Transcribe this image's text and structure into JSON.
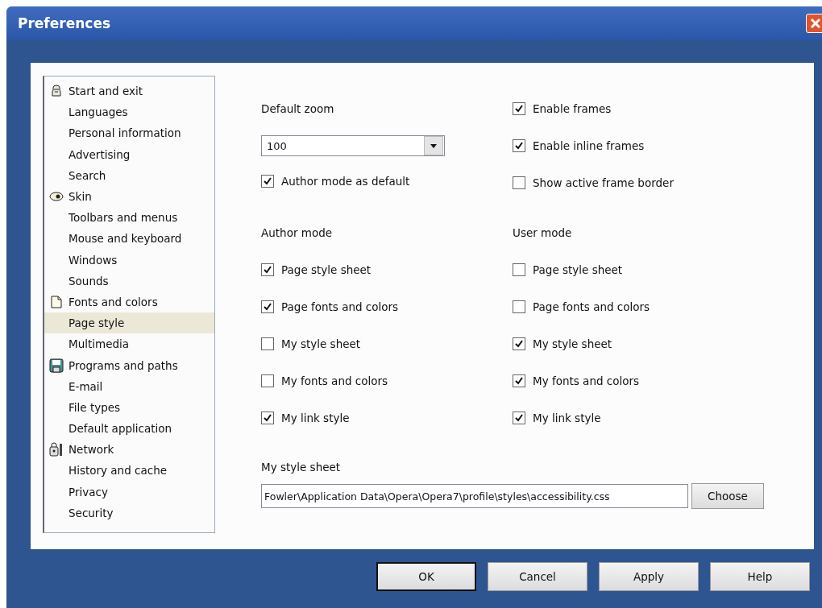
{
  "window": {
    "title": "Preferences"
  },
  "sidebar": {
    "items": [
      {
        "label": "Start and exit",
        "kind": "section",
        "selected": false
      },
      {
        "label": "Languages",
        "kind": "page",
        "selected": false
      },
      {
        "label": "Personal information",
        "kind": "page",
        "selected": false
      },
      {
        "label": "Advertising",
        "kind": "page",
        "selected": false
      },
      {
        "label": "Search",
        "kind": "page",
        "selected": false
      },
      {
        "label": "Skin",
        "kind": "section",
        "selected": false
      },
      {
        "label": "Toolbars and menus",
        "kind": "page",
        "selected": false
      },
      {
        "label": "Mouse and keyboard",
        "kind": "page",
        "selected": false
      },
      {
        "label": "Windows",
        "kind": "page",
        "selected": false
      },
      {
        "label": "Sounds",
        "kind": "page",
        "selected": false
      },
      {
        "label": "Fonts and colors",
        "kind": "section",
        "selected": false
      },
      {
        "label": "Page style",
        "kind": "page",
        "selected": true
      },
      {
        "label": "Multimedia",
        "kind": "page",
        "selected": false
      },
      {
        "label": "Programs and paths",
        "kind": "section",
        "selected": false
      },
      {
        "label": "E-mail",
        "kind": "page",
        "selected": false
      },
      {
        "label": "File types",
        "kind": "page",
        "selected": false
      },
      {
        "label": "Default application",
        "kind": "page",
        "selected": false
      },
      {
        "label": "Network",
        "kind": "section",
        "selected": false
      },
      {
        "label": "History and cache",
        "kind": "page",
        "selected": false
      },
      {
        "label": "Privacy",
        "kind": "page",
        "selected": false
      },
      {
        "label": "Security",
        "kind": "page",
        "selected": false
      }
    ]
  },
  "default_zoom": {
    "label": "Default zoom",
    "value": "100"
  },
  "author_mode_default": {
    "label": "Author mode as default",
    "checked": true
  },
  "frames": [
    {
      "label": "Enable frames",
      "checked": true
    },
    {
      "label": "Enable inline frames",
      "checked": true
    },
    {
      "label": "Show active frame border",
      "checked": false
    }
  ],
  "author_mode": {
    "title": "Author mode",
    "options": [
      {
        "label": "Page style sheet",
        "checked": true
      },
      {
        "label": "Page fonts and colors",
        "checked": true
      },
      {
        "label": "My style sheet",
        "checked": false
      },
      {
        "label": "My fonts and colors",
        "checked": false
      },
      {
        "label": "My link style",
        "checked": true
      }
    ]
  },
  "user_mode": {
    "title": "User mode",
    "options": [
      {
        "label": "Page style sheet",
        "checked": false
      },
      {
        "label": "Page fonts and colors",
        "checked": false
      },
      {
        "label": "My style sheet",
        "checked": true
      },
      {
        "label": "My fonts and colors",
        "checked": true
      },
      {
        "label": "My link style",
        "checked": true
      }
    ]
  },
  "style_sheet": {
    "label": "My style sheet",
    "value": "Fowler\\Application Data\\Opera\\Opera7\\profile\\styles\\accessibility.css",
    "button": "Choose"
  },
  "buttons": [
    "OK",
    "Cancel",
    "Apply",
    "Help"
  ]
}
